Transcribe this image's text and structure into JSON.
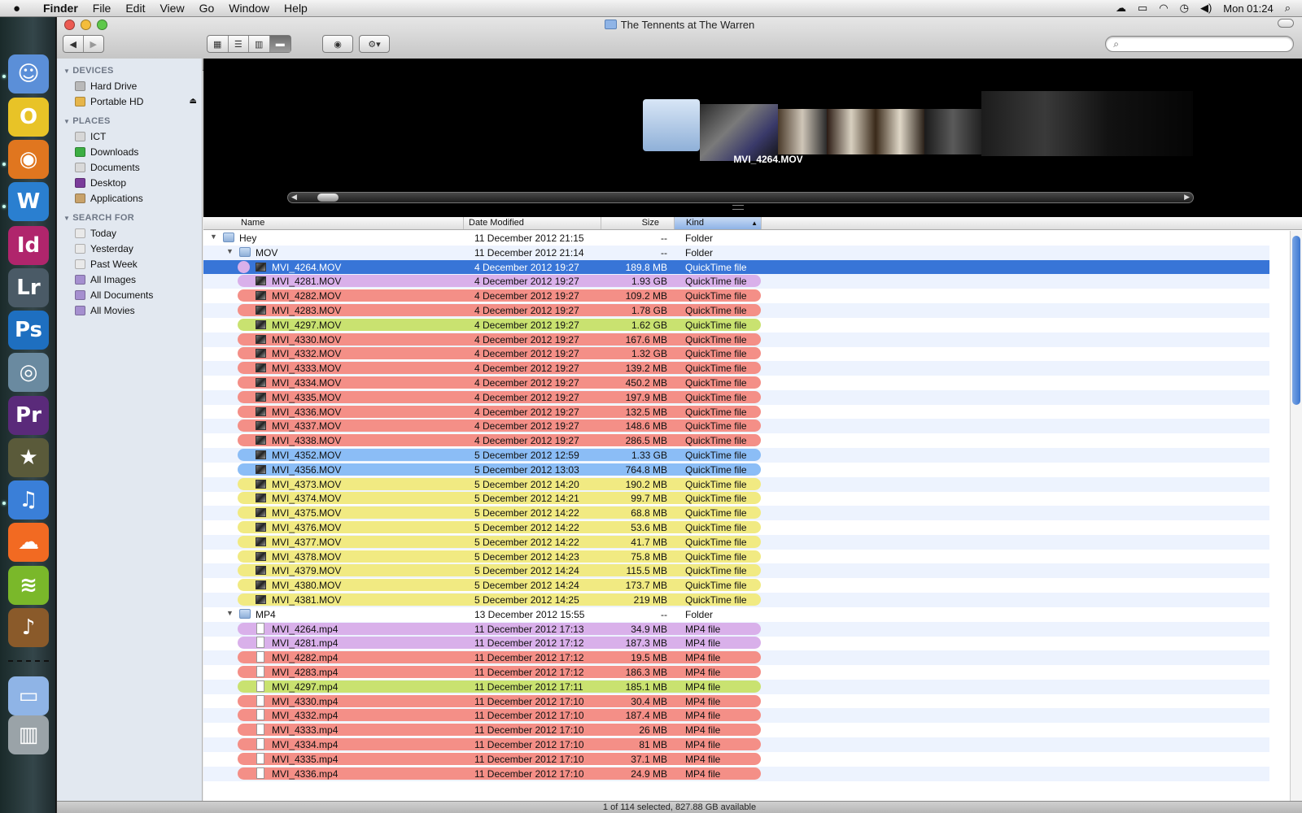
{
  "menubar": {
    "app": "Finder",
    "items": [
      "File",
      "Edit",
      "View",
      "Go",
      "Window",
      "Help"
    ],
    "clock": "Mon 01:24"
  },
  "window": {
    "title": "The Tennents at The Warren"
  },
  "toolbar": {
    "search_placeholder": ""
  },
  "sidebar": {
    "devices_header": "DEVICES",
    "devices": [
      {
        "label": "Hard Drive",
        "icon": "hard-drive-icon",
        "color": "#b9b9b9"
      },
      {
        "label": "Portable HD",
        "icon": "external-drive-icon",
        "color": "#e6b54a"
      }
    ],
    "places_header": "PLACES",
    "places": [
      {
        "label": "ICT",
        "icon": "home-icon",
        "color": "#d7d7d7"
      },
      {
        "label": "Downloads",
        "icon": "downloads-icon",
        "color": "#3cae43"
      },
      {
        "label": "Documents",
        "icon": "documents-icon",
        "color": "#d9d9d9"
      },
      {
        "label": "Desktop",
        "icon": "desktop-icon",
        "color": "#7a3c9a"
      },
      {
        "label": "Applications",
        "icon": "applications-icon",
        "color": "#c8a26a"
      }
    ],
    "search_header": "SEARCH FOR",
    "searches": [
      {
        "label": "Today",
        "icon": "clock-icon",
        "color": "#e9e9e9"
      },
      {
        "label": "Yesterday",
        "icon": "clock-icon",
        "color": "#e9e9e9"
      },
      {
        "label": "Past Week",
        "icon": "clock-icon",
        "color": "#e9e9e9"
      },
      {
        "label": "All Images",
        "icon": "smart-folder-icon",
        "color": "#a58fcf"
      },
      {
        "label": "All Documents",
        "icon": "smart-folder-icon",
        "color": "#a58fcf"
      },
      {
        "label": "All Movies",
        "icon": "smart-folder-icon",
        "color": "#a58fcf"
      }
    ]
  },
  "coverflow": {
    "selected_name": "MVI_4264.MOV"
  },
  "columns": {
    "name": "Name",
    "date": "Date Modified",
    "size": "Size",
    "kind": "Kind"
  },
  "label_colors": {
    "purple": "#d9b0ea",
    "red": "#f48f87",
    "green": "#c9e270",
    "blue": "#8bbdf6",
    "yellow": "#f1ea82"
  },
  "rows": [
    {
      "indent": 0,
      "type": "folder",
      "disclosure": "▼",
      "name": "Hey",
      "date": "11 December 2012 21:15",
      "size": "--",
      "kind": "Folder",
      "label": ""
    },
    {
      "indent": 1,
      "type": "folder",
      "disclosure": "▼",
      "name": "MOV",
      "date": "11 December 2012 21:14",
      "size": "--",
      "kind": "Folder",
      "label": ""
    },
    {
      "indent": 2,
      "type": "movie",
      "name": "MVI_4264.MOV",
      "date": "4 December 2012 19:27",
      "size": "189.8 MB",
      "kind": "QuickTime file",
      "label": "purple",
      "selected": true
    },
    {
      "indent": 2,
      "type": "movie",
      "name": "MVI_4281.MOV",
      "date": "4 December 2012 19:27",
      "size": "1.93 GB",
      "kind": "QuickTime file",
      "label": "purple"
    },
    {
      "indent": 2,
      "type": "movie",
      "name": "MVI_4282.MOV",
      "date": "4 December 2012 19:27",
      "size": "109.2 MB",
      "kind": "QuickTime file",
      "label": "red"
    },
    {
      "indent": 2,
      "type": "movie",
      "name": "MVI_4283.MOV",
      "date": "4 December 2012 19:27",
      "size": "1.78 GB",
      "kind": "QuickTime file",
      "label": "red"
    },
    {
      "indent": 2,
      "type": "movie",
      "name": "MVI_4297.MOV",
      "date": "4 December 2012 19:27",
      "size": "1.62 GB",
      "kind": "QuickTime file",
      "label": "green"
    },
    {
      "indent": 2,
      "type": "movie",
      "name": "MVI_4330.MOV",
      "date": "4 December 2012 19:27",
      "size": "167.6 MB",
      "kind": "QuickTime file",
      "label": "red"
    },
    {
      "indent": 2,
      "type": "movie",
      "name": "MVI_4332.MOV",
      "date": "4 December 2012 19:27",
      "size": "1.32 GB",
      "kind": "QuickTime file",
      "label": "red"
    },
    {
      "indent": 2,
      "type": "movie",
      "name": "MVI_4333.MOV",
      "date": "4 December 2012 19:27",
      "size": "139.2 MB",
      "kind": "QuickTime file",
      "label": "red"
    },
    {
      "indent": 2,
      "type": "movie",
      "name": "MVI_4334.MOV",
      "date": "4 December 2012 19:27",
      "size": "450.2 MB",
      "kind": "QuickTime file",
      "label": "red"
    },
    {
      "indent": 2,
      "type": "movie",
      "name": "MVI_4335.MOV",
      "date": "4 December 2012 19:27",
      "size": "197.9 MB",
      "kind": "QuickTime file",
      "label": "red"
    },
    {
      "indent": 2,
      "type": "movie",
      "name": "MVI_4336.MOV",
      "date": "4 December 2012 19:27",
      "size": "132.5 MB",
      "kind": "QuickTime file",
      "label": "red"
    },
    {
      "indent": 2,
      "type": "movie",
      "name": "MVI_4337.MOV",
      "date": "4 December 2012 19:27",
      "size": "148.6 MB",
      "kind": "QuickTime file",
      "label": "red"
    },
    {
      "indent": 2,
      "type": "movie",
      "name": "MVI_4338.MOV",
      "date": "4 December 2012 19:27",
      "size": "286.5 MB",
      "kind": "QuickTime file",
      "label": "red"
    },
    {
      "indent": 2,
      "type": "movie",
      "name": "MVI_4352.MOV",
      "date": "5 December 2012 12:59",
      "size": "1.33 GB",
      "kind": "QuickTime file",
      "label": "blue"
    },
    {
      "indent": 2,
      "type": "movie",
      "name": "MVI_4356.MOV",
      "date": "5 December 2012 13:03",
      "size": "764.8 MB",
      "kind": "QuickTime file",
      "label": "blue"
    },
    {
      "indent": 2,
      "type": "movie",
      "name": "MVI_4373.MOV",
      "date": "5 December 2012 14:20",
      "size": "190.2 MB",
      "kind": "QuickTime file",
      "label": "yellow"
    },
    {
      "indent": 2,
      "type": "movie",
      "name": "MVI_4374.MOV",
      "date": "5 December 2012 14:21",
      "size": "99.7 MB",
      "kind": "QuickTime file",
      "label": "yellow"
    },
    {
      "indent": 2,
      "type": "movie",
      "name": "MVI_4375.MOV",
      "date": "5 December 2012 14:22",
      "size": "68.8 MB",
      "kind": "QuickTime file",
      "label": "yellow"
    },
    {
      "indent": 2,
      "type": "movie",
      "name": "MVI_4376.MOV",
      "date": "5 December 2012 14:22",
      "size": "53.6 MB",
      "kind": "QuickTime file",
      "label": "yellow"
    },
    {
      "indent": 2,
      "type": "movie",
      "name": "MVI_4377.MOV",
      "date": "5 December 2012 14:22",
      "size": "41.7 MB",
      "kind": "QuickTime file",
      "label": "yellow"
    },
    {
      "indent": 2,
      "type": "movie",
      "name": "MVI_4378.MOV",
      "date": "5 December 2012 14:23",
      "size": "75.8 MB",
      "kind": "QuickTime file",
      "label": "yellow"
    },
    {
      "indent": 2,
      "type": "movie",
      "name": "MVI_4379.MOV",
      "date": "5 December 2012 14:24",
      "size": "115.5 MB",
      "kind": "QuickTime file",
      "label": "yellow"
    },
    {
      "indent": 2,
      "type": "movie",
      "name": "MVI_4380.MOV",
      "date": "5 December 2012 14:24",
      "size": "173.7 MB",
      "kind": "QuickTime file",
      "label": "yellow"
    },
    {
      "indent": 2,
      "type": "movie",
      "name": "MVI_4381.MOV",
      "date": "5 December 2012 14:25",
      "size": "219 MB",
      "kind": "QuickTime file",
      "label": "yellow"
    },
    {
      "indent": 1,
      "type": "folder",
      "disclosure": "▼",
      "name": "MP4",
      "date": "13 December 2012 15:55",
      "size": "--",
      "kind": "Folder",
      "label": ""
    },
    {
      "indent": 2,
      "type": "doc",
      "name": "MVI_4264.mp4",
      "date": "11 December 2012 17:13",
      "size": "34.9 MB",
      "kind": "MP4 file",
      "label": "purple"
    },
    {
      "indent": 2,
      "type": "doc",
      "name": "MVI_4281.mp4",
      "date": "11 December 2012 17:12",
      "size": "187.3 MB",
      "kind": "MP4 file",
      "label": "purple"
    },
    {
      "indent": 2,
      "type": "doc",
      "name": "MVI_4282.mp4",
      "date": "11 December 2012 17:12",
      "size": "19.5 MB",
      "kind": "MP4 file",
      "label": "red"
    },
    {
      "indent": 2,
      "type": "doc",
      "name": "MVI_4283.mp4",
      "date": "11 December 2012 17:12",
      "size": "186.3 MB",
      "kind": "MP4 file",
      "label": "red"
    },
    {
      "indent": 2,
      "type": "doc",
      "name": "MVI_4297.mp4",
      "date": "11 December 2012 17:11",
      "size": "185.1 MB",
      "kind": "MP4 file",
      "label": "green"
    },
    {
      "indent": 2,
      "type": "doc",
      "name": "MVI_4330.mp4",
      "date": "11 December 2012 17:10",
      "size": "30.4 MB",
      "kind": "MP4 file",
      "label": "red"
    },
    {
      "indent": 2,
      "type": "doc",
      "name": "MVI_4332.mp4",
      "date": "11 December 2012 17:10",
      "size": "187.4 MB",
      "kind": "MP4 file",
      "label": "red"
    },
    {
      "indent": 2,
      "type": "doc",
      "name": "MVI_4333.mp4",
      "date": "11 December 2012 17:10",
      "size": "26 MB",
      "kind": "MP4 file",
      "label": "red"
    },
    {
      "indent": 2,
      "type": "doc",
      "name": "MVI_4334.mp4",
      "date": "11 December 2012 17:10",
      "size": "81 MB",
      "kind": "MP4 file",
      "label": "red"
    },
    {
      "indent": 2,
      "type": "doc",
      "name": "MVI_4335.mp4",
      "date": "11 December 2012 17:10",
      "size": "37.1 MB",
      "kind": "MP4 file",
      "label": "red"
    },
    {
      "indent": 2,
      "type": "doc",
      "name": "MVI_4336.mp4",
      "date": "11 December 2012 17:10",
      "size": "24.9 MB",
      "kind": "MP4 file",
      "label": "red"
    }
  ],
  "status": "1 of 114 selected, 827.88 GB available",
  "dock": [
    {
      "name": "finder-icon",
      "glyph": "☺",
      "color": "#5b8fd8"
    },
    {
      "name": "opera-icon",
      "glyph": "O",
      "color": "#e8c327"
    },
    {
      "name": "firefox-icon",
      "glyph": "◉",
      "color": "#e0761f"
    },
    {
      "name": "word-icon",
      "glyph": "W",
      "color": "#2a7fd0"
    },
    {
      "name": "indesign-icon",
      "glyph": "Id",
      "color": "#b0256c"
    },
    {
      "name": "lightroom-icon",
      "glyph": "Lr",
      "color": "#4a5a66"
    },
    {
      "name": "photoshop-icon",
      "glyph": "Ps",
      "color": "#1e6fc0"
    },
    {
      "name": "aperture-icon",
      "glyph": "◎",
      "color": "#6a8aa0"
    },
    {
      "name": "premiere-icon",
      "glyph": "Pr",
      "color": "#5a2a7a"
    },
    {
      "name": "imovie-icon",
      "glyph": "★",
      "color": "#5a5a3a"
    },
    {
      "name": "itunes-icon",
      "glyph": "♫",
      "color": "#3a7fd8"
    },
    {
      "name": "soundcloud-icon",
      "glyph": "☁",
      "color": "#f26a22"
    },
    {
      "name": "spotify-icon",
      "glyph": "≋",
      "color": "#7ab82a"
    },
    {
      "name": "garageband-icon",
      "glyph": "♪",
      "color": "#8a5a2a"
    },
    {
      "name": "downloads-stack-icon",
      "glyph": "▭",
      "color": "#8fb4e6"
    },
    {
      "name": "trash-icon",
      "glyph": "▥",
      "color": "#9aa3a8"
    }
  ]
}
